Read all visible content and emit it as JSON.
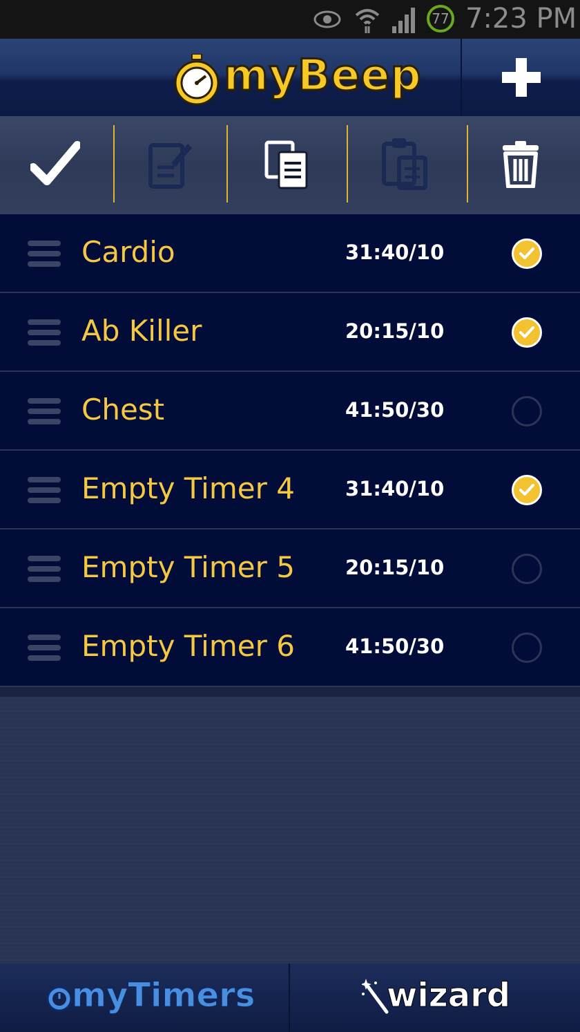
{
  "status_bar": {
    "battery_level": "77",
    "time": "7:23 PM",
    "icons": [
      "eye-icon",
      "wifi-icon",
      "signal-icon"
    ]
  },
  "header": {
    "brand": "myBeep",
    "add_icon": "plus-icon"
  },
  "toolbar": {
    "buttons": [
      "check-icon",
      "edit-icon",
      "copy-icon",
      "paste-icon",
      "trash-icon"
    ]
  },
  "timers": [
    {
      "name": "Cardio",
      "time": "31:40/10",
      "checked": true
    },
    {
      "name": "Ab Killer",
      "time": "20:15/10",
      "checked": true
    },
    {
      "name": "Chest",
      "time": "41:50/30",
      "checked": false
    },
    {
      "name": "Empty Timer 4",
      "time": "31:40/10",
      "checked": true
    },
    {
      "name": "Empty Timer 5",
      "time": "20:15/10",
      "checked": false
    },
    {
      "name": "Empty Timer 6",
      "time": "41:50/30",
      "checked": false
    }
  ],
  "tabs": {
    "mytimers": "myTimers",
    "wizard": "wizard"
  },
  "colors": {
    "accent": "#f5c844",
    "row_bg": "#020c38",
    "tab_blue": "#4a8ee0"
  }
}
